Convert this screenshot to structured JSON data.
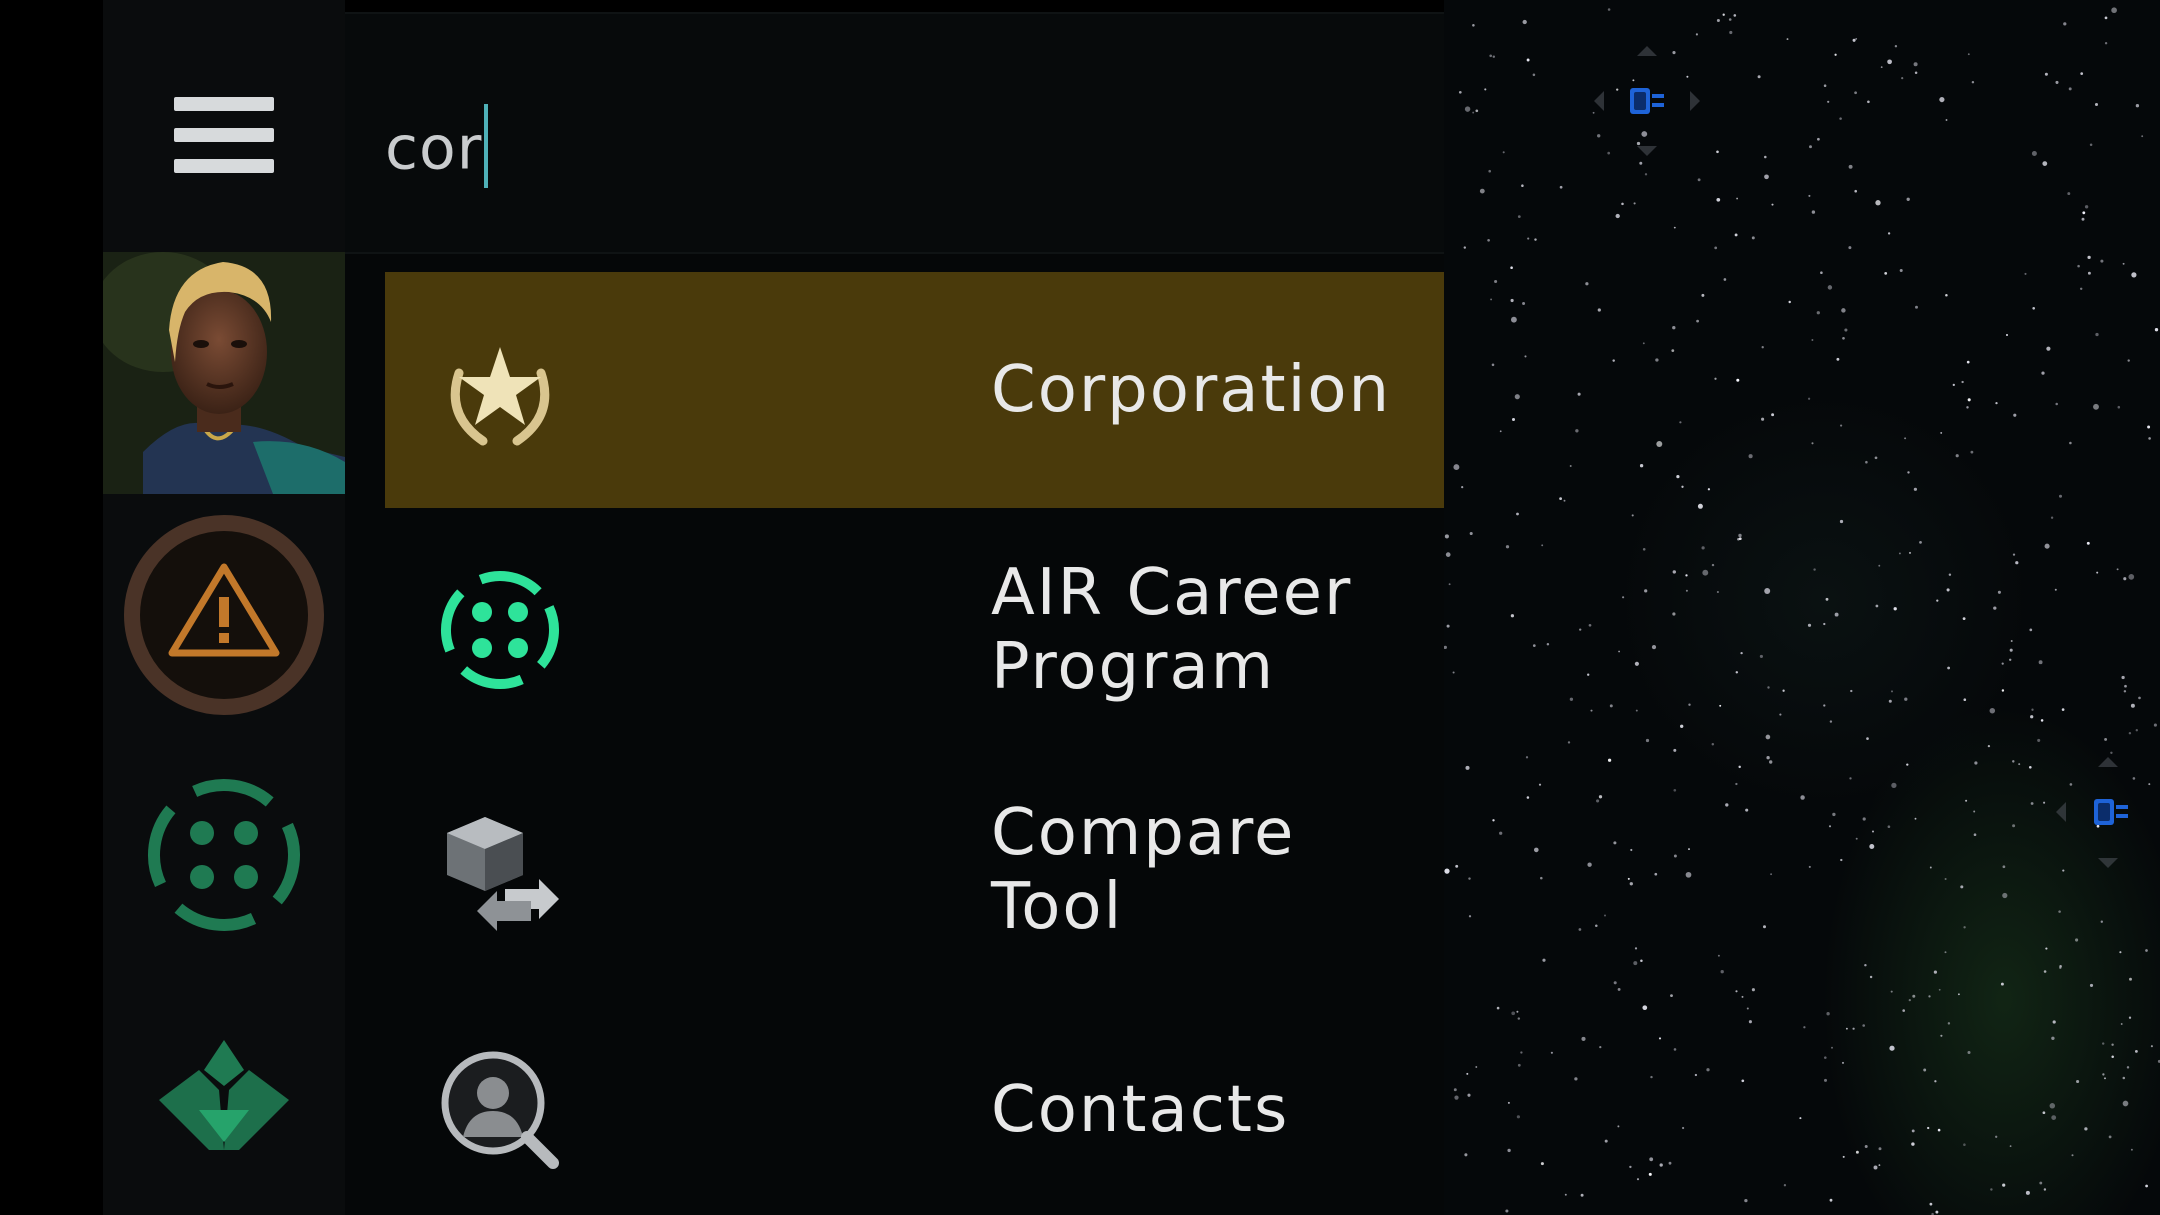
{
  "search": {
    "value": "cor"
  },
  "sidebar": {
    "menu_icon": "hamburger-menu-icon",
    "avatar": "character-portrait",
    "items": [
      {
        "icon": "warning-icon",
        "color": "#c2782a"
      },
      {
        "icon": "air-career-program-icon",
        "color": "#2aa36b"
      },
      {
        "icon": "agency-icon",
        "color": "#2aa36b"
      }
    ]
  },
  "results": [
    {
      "label": "Corporation",
      "icon": "corporation-star-icon",
      "selected": true
    },
    {
      "label": "AIR Career Program",
      "icon": "air-career-program-icon",
      "selected": false
    },
    {
      "label": "Compare Tool",
      "icon": "compare-tool-icon",
      "selected": false
    },
    {
      "label": "Contacts",
      "icon": "contacts-icon",
      "selected": false
    }
  ],
  "colors": {
    "selected_row": "#4a3a0b",
    "accent_green": "#2ee39a",
    "caret": "#4fb1b8"
  }
}
